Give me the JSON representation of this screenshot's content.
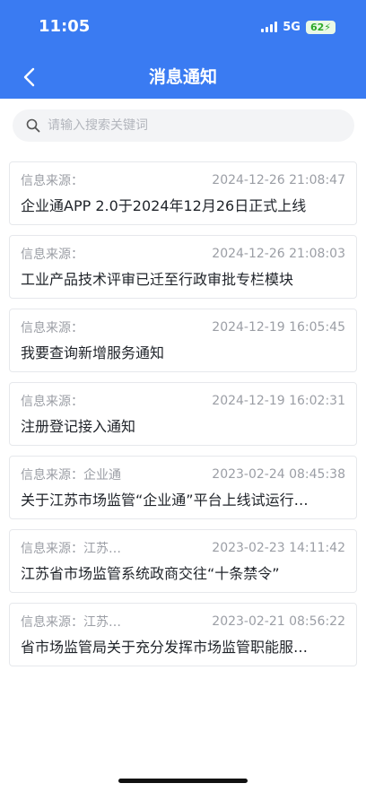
{
  "status": {
    "time": "11:05",
    "network": "5G",
    "battery": "62"
  },
  "header": {
    "title": "消息通知"
  },
  "search": {
    "placeholder": "请输入搜索关键词"
  },
  "notices": [
    {
      "source": "信息来源：",
      "time": "2024-12-26 21:08:47",
      "title": "企业通APP 2.0于2024年12月26日正式上线"
    },
    {
      "source": "信息来源：",
      "time": "2024-12-26 21:08:03",
      "title": "工业产品技术评审已迁至行政审批专栏模块"
    },
    {
      "source": "信息来源：",
      "time": "2024-12-19 16:05:45",
      "title": "我要查询新增服务通知"
    },
    {
      "source": "信息来源：",
      "time": "2024-12-19 16:02:31",
      "title": "注册登记接入通知"
    },
    {
      "source": "信息来源：企业通",
      "time": "2023-02-24 08:45:38",
      "title": "关于江苏市场监管“企业通”平台上线试运行…"
    },
    {
      "source": "信息来源：江苏…",
      "time": "2023-02-23 14:11:42",
      "title": "江苏省市场监管系统政商交往“十条禁令”"
    },
    {
      "source": "信息来源：江苏…",
      "time": "2023-02-21 08:56:22",
      "title": "省市场监管局关于充分发挥市场监管职能服…"
    }
  ]
}
